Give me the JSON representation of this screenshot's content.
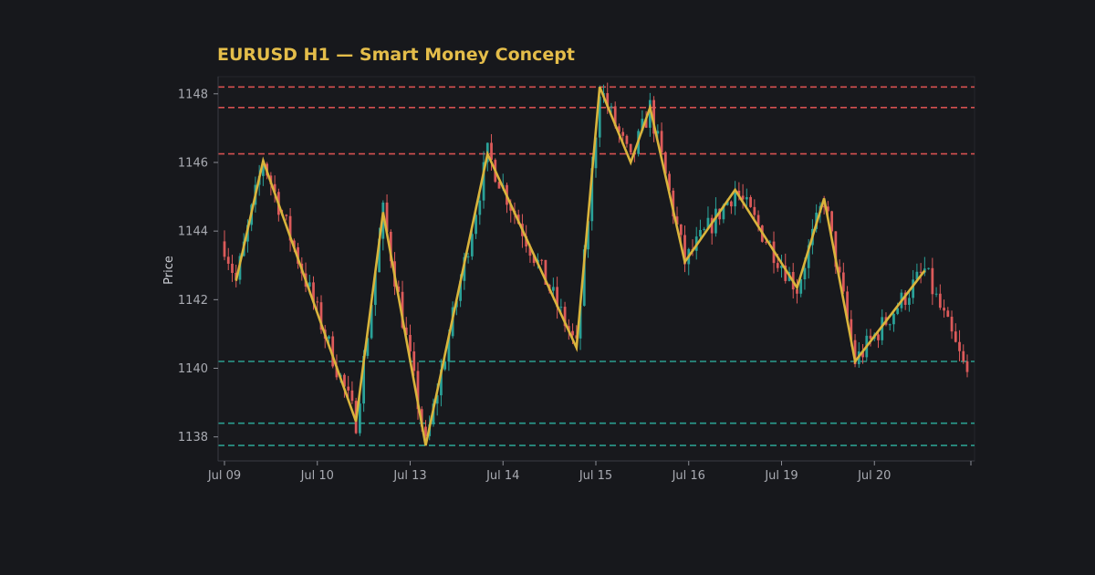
{
  "chart_data": {
    "type": "candlestick",
    "title": "EURUSD H1 — Smart Money Concept",
    "xlabel": "",
    "ylabel": "Price",
    "ylim": [
      1137.3,
      1148.5
    ],
    "y_ticks": [
      1138,
      1140,
      1142,
      1144,
      1146,
      1148
    ],
    "x_ticks": [
      {
        "label": "Jul 09",
        "index": 0
      },
      {
        "label": "Jul 10",
        "index": 24
      },
      {
        "label": "Jul 13",
        "index": 48
      },
      {
        "label": "Jul 14",
        "index": 72
      },
      {
        "label": "Jul 15",
        "index": 96
      },
      {
        "label": "Jul 16",
        "index": 120
      },
      {
        "label": "Jul 19",
        "index": 144
      },
      {
        "label": "Jul 20",
        "index": 168
      }
    ],
    "candle_count": 193,
    "grid": false,
    "colors": {
      "background": "#17181c",
      "plot_background": "#18191d",
      "title": "#e4bd4a",
      "bull": "#2aa198",
      "bear": "#dc5a5a",
      "zigzag": "#d9b43c",
      "resistance": "#d45050",
      "support": "#2a9d8f",
      "axis": "#3a3c44"
    },
    "zigzag": [
      {
        "i": 3,
        "price": 1142.55
      },
      {
        "i": 10,
        "price": 1146.05
      },
      {
        "i": 34,
        "price": 1138.45
      },
      {
        "i": 41,
        "price": 1144.55
      },
      {
        "i": 52,
        "price": 1137.75
      },
      {
        "i": 68,
        "price": 1146.25
      },
      {
        "i": 91,
        "price": 1140.6
      },
      {
        "i": 97,
        "price": 1148.2
      },
      {
        "i": 105,
        "price": 1146.0
      },
      {
        "i": 110,
        "price": 1147.6
      },
      {
        "i": 119,
        "price": 1143.1
      },
      {
        "i": 132,
        "price": 1145.2
      },
      {
        "i": 148,
        "price": 1142.35
      },
      {
        "i": 155,
        "price": 1144.95
      },
      {
        "i": 163,
        "price": 1140.2
      },
      {
        "i": 181,
        "price": 1142.85
      }
    ],
    "resistance_levels": [
      1148.2,
      1147.6,
      1146.25
    ],
    "support_levels": [
      1140.2,
      1138.4,
      1137.75
    ],
    "series": [
      {
        "name": "OHLC",
        "close_path_note": "",
        "end_close": 1139.8
      }
    ]
  }
}
